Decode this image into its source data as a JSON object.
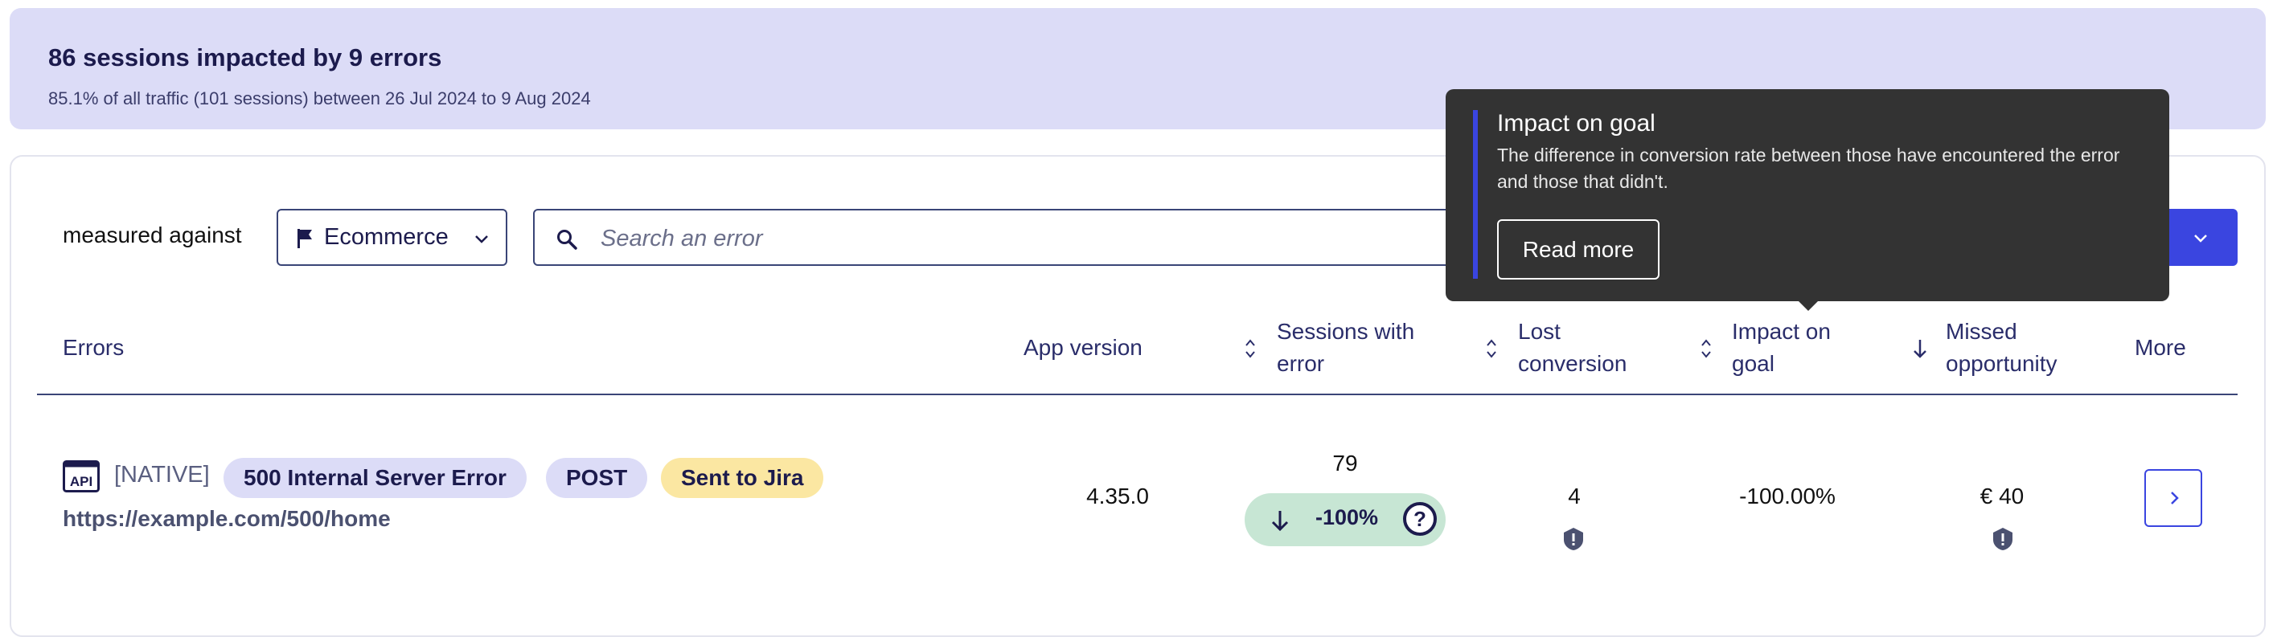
{
  "banner": {
    "title": "86 sessions impacted by 9 errors",
    "subtitle": "85.1% of all traffic (101 sessions) between 26 Jul 2024 to 9 Aug 2024"
  },
  "filters": {
    "measured_label": "measured against",
    "goal_value": "Ecommerce",
    "search_placeholder": "Search an error"
  },
  "table": {
    "headers": {
      "errors": "Errors",
      "app_version": "App version",
      "sessions_line1": "Sessions with",
      "sessions_line2": "error",
      "lost_line1": "Lost",
      "lost_line2": "conversion",
      "impact_line1": "Impact on",
      "impact_line2": "goal",
      "missed_line1": "Missed",
      "missed_line2": "opportunity",
      "more": "More"
    },
    "rows": [
      {
        "type_label": "[NATIVE]",
        "tags": [
          "500 Internal Server Error",
          "POST",
          "Sent to Jira"
        ],
        "url": "https://example.com/500/home",
        "app_version": "4.35.0",
        "sessions": "79",
        "sessions_change": "-100%",
        "lost_conversion": "4",
        "impact_on_goal": "-100.00%",
        "missed_opportunity": "€ 40"
      }
    ]
  },
  "tooltip": {
    "title": "Impact on goal",
    "body": "The difference in conversion rate between those have encountered the error and those that didn't.",
    "button": "Read more"
  },
  "colors": {
    "banner_bg": "#dcdcf7",
    "accent": "#3a45e0",
    "success_bg": "#c7e6d4",
    "jira_bg": "#fbe7a2",
    "tooltip_bg": "#333333"
  }
}
